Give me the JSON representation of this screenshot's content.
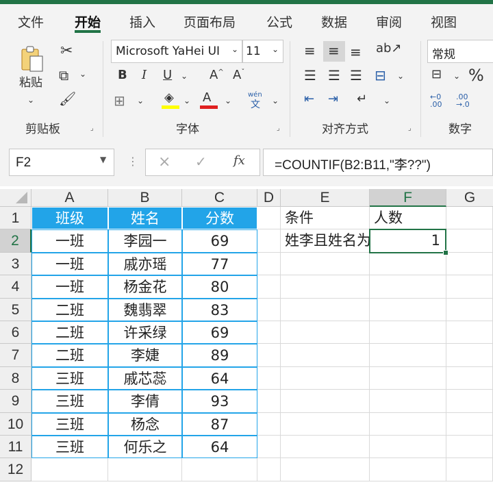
{
  "ribbon_tabs": [
    "文件",
    "开始",
    "插入",
    "页面布局",
    "公式",
    "数据",
    "审阅",
    "视图"
  ],
  "clipboard": {
    "paste_label": "粘贴",
    "group_label": "剪贴板"
  },
  "font": {
    "name": "Microsoft YaHei UI",
    "size": "11",
    "group_label": "字体",
    "bold": "B",
    "italic": "I",
    "underline": "U",
    "grow": "A",
    "shrink": "A",
    "font_color": "A",
    "phonetic": "wén"
  },
  "alignment": {
    "group_label": "对齐方式"
  },
  "number": {
    "format": "常规",
    "percent": "%",
    "group_label": "数字",
    "inc_decimal": ".00",
    "dec_decimal": ".0"
  },
  "formula_bar": {
    "name_box": "F2",
    "cancel": "×",
    "confirm": "✓",
    "fx": "fx",
    "formula": "=COUNTIF(B2:B11,\"李??\")"
  },
  "columns": [
    "A",
    "B",
    "C",
    "D",
    "E",
    "F",
    "G"
  ],
  "rows": [
    "1",
    "2",
    "3",
    "4",
    "5",
    "6",
    "7",
    "8",
    "9",
    "10",
    "11",
    "12"
  ],
  "table": {
    "headers": [
      "班级",
      "姓名",
      "分数"
    ],
    "rows": [
      [
        "一班",
        "李园一",
        "69"
      ],
      [
        "一班",
        "戚亦瑶",
        "77"
      ],
      [
        "一班",
        "杨金花",
        "80"
      ],
      [
        "二班",
        "魏翡翠",
        "83"
      ],
      [
        "二班",
        "许采绿",
        "69"
      ],
      [
        "二班",
        "李婕",
        "89"
      ],
      [
        "三班",
        "戚芯蕊",
        "64"
      ],
      [
        "三班",
        "李倩",
        "93"
      ],
      [
        "三班",
        "杨念",
        "87"
      ],
      [
        "三班",
        "何乐之",
        "64"
      ]
    ]
  },
  "result": {
    "condition_header": "条件",
    "count_header": "人数",
    "condition_value": "姓李且姓名为",
    "count_value": "1"
  },
  "colors": {
    "accent": "#217346",
    "table_header": "#22a4e8",
    "table_border": "#22a4e8"
  }
}
